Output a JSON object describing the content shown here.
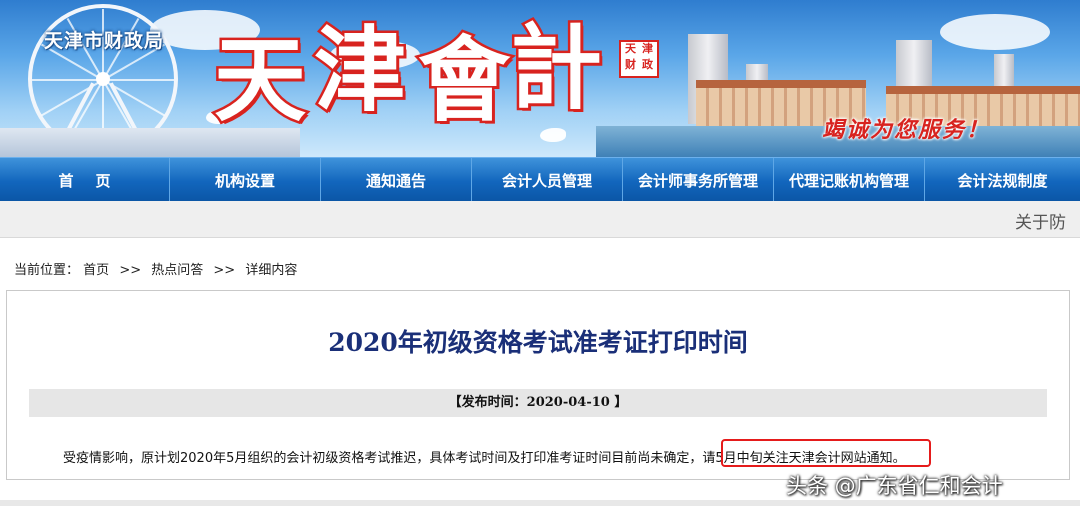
{
  "header": {
    "org_name": "天津市财政局",
    "title_chars": [
      "天",
      "津",
      "會",
      "計"
    ],
    "seal_chars": [
      "天",
      "津",
      "财",
      "政"
    ],
    "slogan": "竭诚为您服务！"
  },
  "nav": {
    "items": [
      "首页",
      "机构设置",
      "通知通告",
      "会计人员管理",
      "会计师事务所管理",
      "代理记账机构管理",
      "会计法规制度"
    ]
  },
  "marquee": {
    "text": "关于防"
  },
  "breadcrumb": {
    "prefix": "当前位置：",
    "items": [
      "首页",
      "热点问答",
      "详细内容"
    ],
    "separator": ">>"
  },
  "article": {
    "title": "2020年初级资格考试准考证打印时间",
    "publish_label": "【发布时间：2020-04-10 】",
    "body": "受疫情影响，原计划2020年5月组织的会计初级资格考试推迟，具体考试时间及打印准考证时间目前尚未确定，请5月中旬关注天津会计网站通知。"
  },
  "watermark": {
    "text": "头条 @广东省仁和会计"
  },
  "colors": {
    "nav_bg": "#1266bd",
    "title_red": "#d8231f",
    "article_title": "#1a2f78",
    "highlight_box": "#e51b1b"
  }
}
